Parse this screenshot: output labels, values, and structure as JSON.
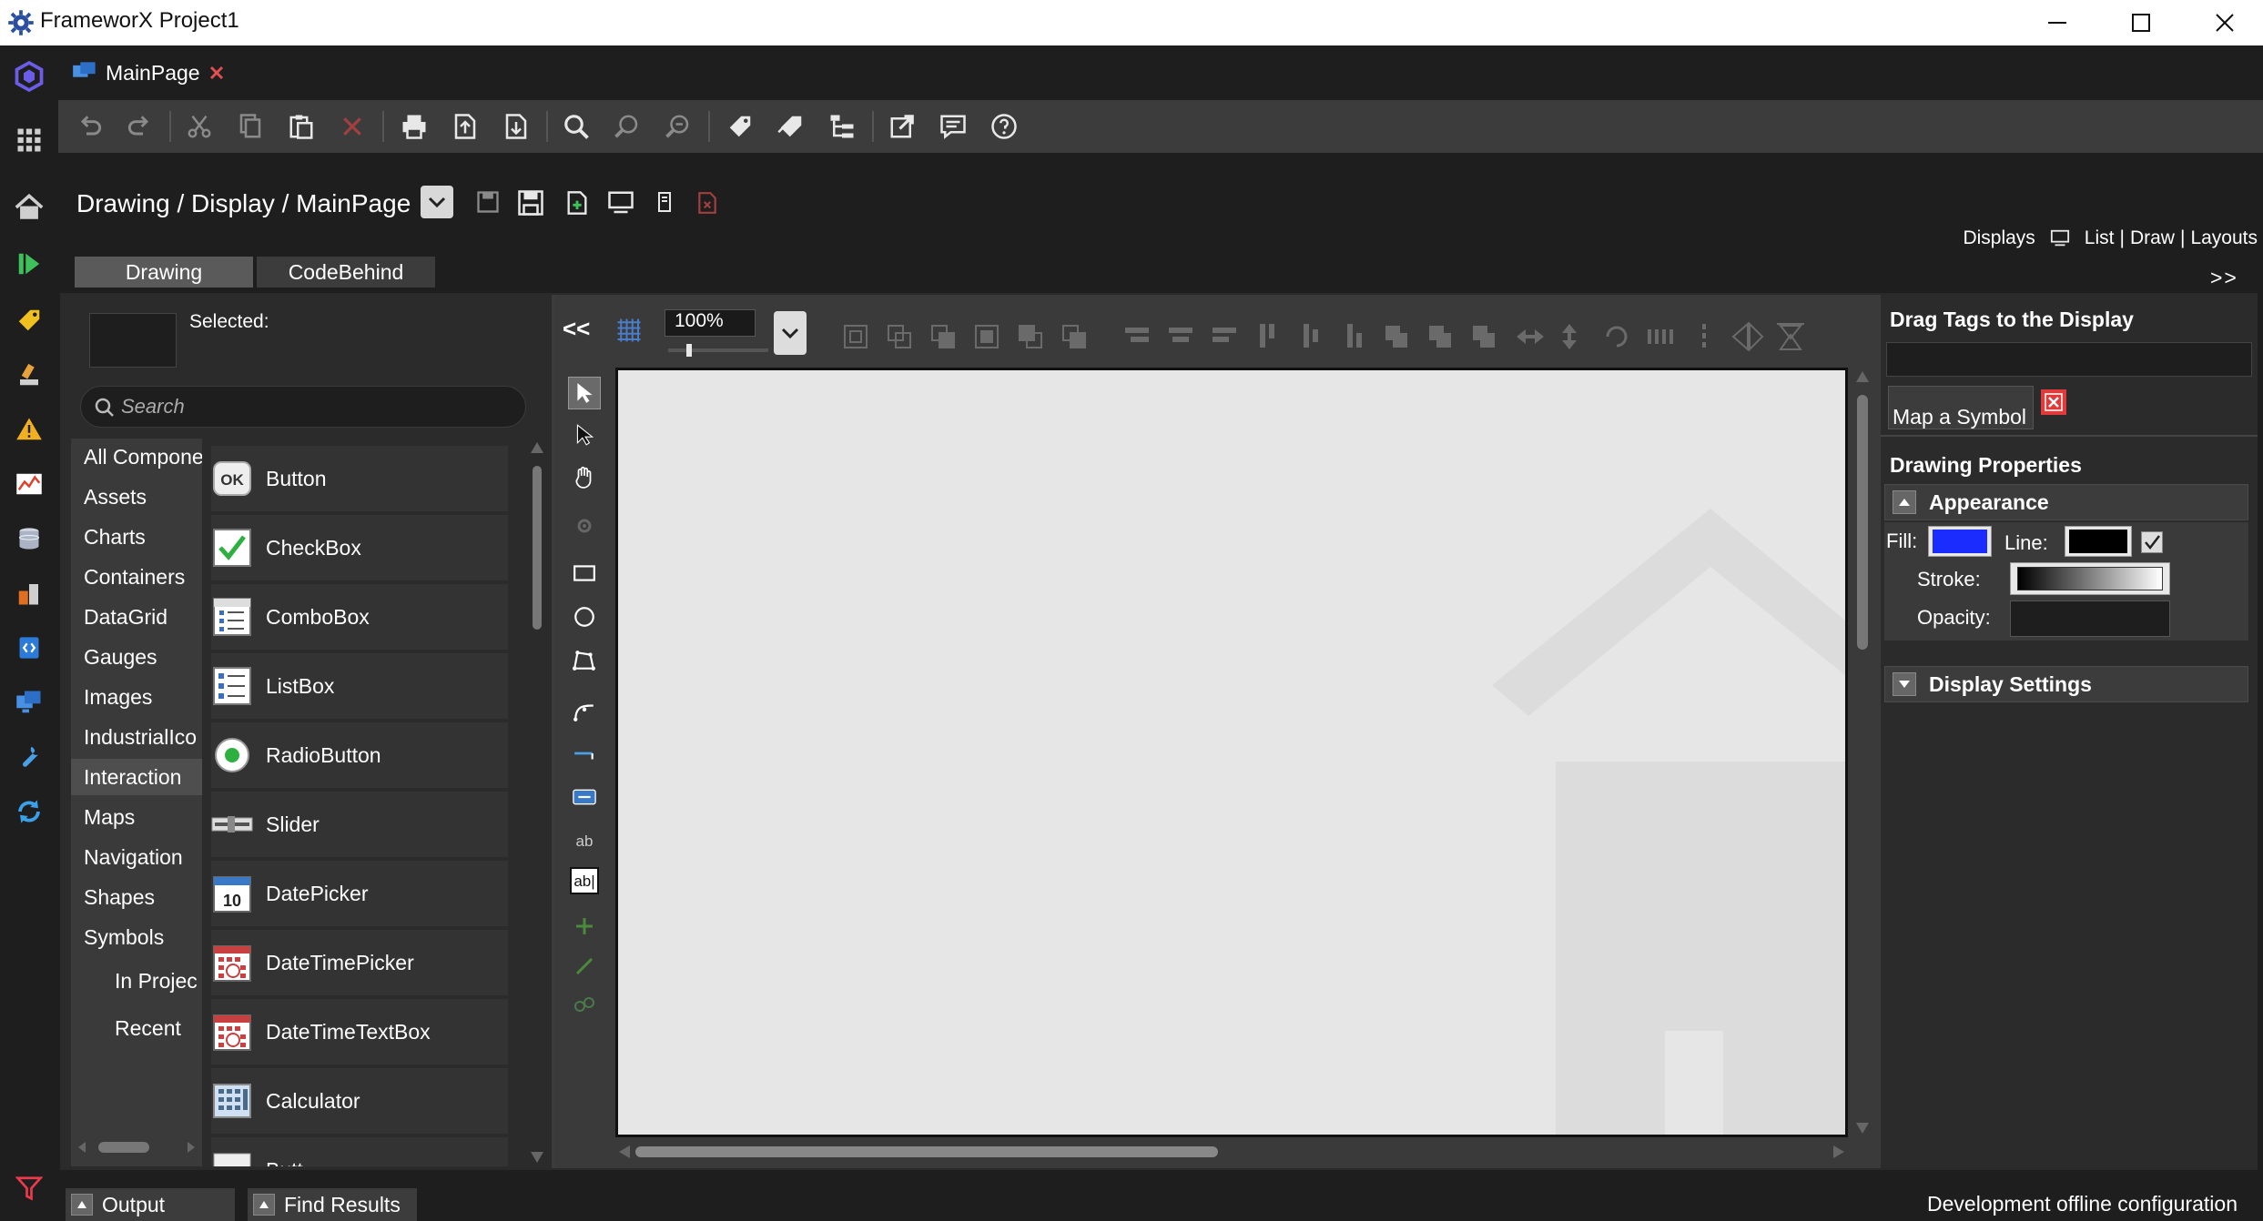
{
  "window": {
    "title": "FrameworX Project1",
    "app_icon": "gear-icon",
    "controls": [
      "minimize-icon",
      "maximize-icon",
      "close-icon"
    ]
  },
  "doc_tab": {
    "label": "MainPage",
    "icon": "display-icon",
    "close_icon": "close-x-icon",
    "close_color": "#e05050"
  },
  "left_rail": {
    "icons": [
      "logo-icon",
      "grid-icon",
      "home-icon",
      "run-icon",
      "tag-icon",
      "tags-edit-icon",
      "alarm-icon",
      "trend-icon",
      "database-icon",
      "scripts-icon",
      "code-icon",
      "displays-icon",
      "tools-icon",
      "sync-icon",
      "filter-icon"
    ]
  },
  "toolbar": {
    "buttons": [
      "undo-icon",
      "redo-icon",
      "cut-icon",
      "copy-icon",
      "paste-icon",
      "delete-icon",
      "print-icon",
      "export-icon",
      "import-icon",
      "find-icon",
      "zoom-in-icon",
      "zoom-out-icon",
      "tag-add-icon",
      "tags-icon",
      "tree-icon",
      "open-external-icon",
      "comment-icon",
      "help-icon"
    ]
  },
  "breadcrumb": {
    "text": "Drawing / Display / MainPage"
  },
  "displays_nav": {
    "label": "Displays",
    "list": "List",
    "sep1": "|",
    "draw": "Draw",
    "sep2": "|",
    "layouts": "Layouts"
  },
  "expand_label": ">>",
  "mode_tabs": {
    "drawing": "Drawing",
    "codebehind": "CodeBehind"
  },
  "components": {
    "selected_label": "Selected:",
    "search_placeholder": "Search",
    "categories": [
      "All Compone",
      "Assets",
      "Charts",
      "Containers",
      "DataGrid",
      "Gauges",
      "Images",
      "IndustrialIco",
      "Interaction",
      "Maps",
      "Navigation",
      "Shapes",
      "Symbols",
      "In Projec",
      "Recent"
    ],
    "active_category": "Interaction",
    "items": [
      {
        "label": "Button",
        "icon": "ok-button-icon"
      },
      {
        "label": "CheckBox",
        "icon": "checkbox-icon"
      },
      {
        "label": "ComboBox",
        "icon": "combobox-icon"
      },
      {
        "label": "ListBox",
        "icon": "listbox-icon"
      },
      {
        "label": "RadioButton",
        "icon": "radio-icon"
      },
      {
        "label": "Slider",
        "icon": "slider-icon"
      },
      {
        "label": "DatePicker",
        "icon": "calendar-icon"
      },
      {
        "label": "DateTimePicker",
        "icon": "datetime-icon"
      },
      {
        "label": "DateTimeTextBox",
        "icon": "datetime-textbox-icon"
      },
      {
        "label": "Calculator",
        "icon": "calculator-icon"
      },
      {
        "label": "Butt",
        "icon": "button-partial-icon"
      }
    ]
  },
  "canvas": {
    "collapse_label": "<<",
    "zoom": "100%"
  },
  "right_panel": {
    "drag_title": "Drag Tags to the Display",
    "map_symbol": "Map a Symbol",
    "drawing_properties": "Drawing Properties",
    "appearance": "Appearance",
    "fill_label": "Fill:",
    "line_label": "Line:",
    "stroke_label": "Stroke:",
    "opacity_label": "Opacity:",
    "display_settings": "Display Settings",
    "fill_color": "#1a2cff",
    "line_color": "#000000"
  },
  "status": {
    "output": "Output",
    "find_results": "Find Results",
    "text": "Development offline configuration"
  }
}
